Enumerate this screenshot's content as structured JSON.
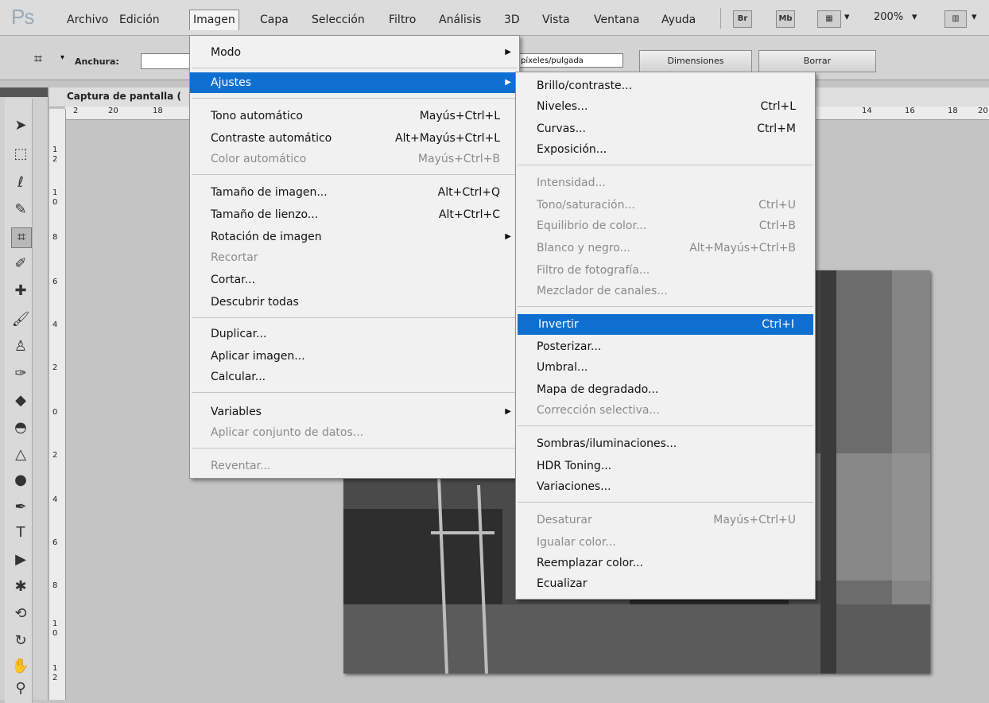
{
  "app": {
    "logo": "Ps"
  },
  "menubar": {
    "items": [
      "Archivo",
      "Edición",
      "Imagen",
      "Capa",
      "Selección",
      "Filtro",
      "Análisis",
      "3D",
      "Vista",
      "Ventana",
      "Ayuda"
    ],
    "br_label": "Br",
    "mb_label": "Mb",
    "zoom": "200%"
  },
  "options": {
    "width_label": "Anchura:",
    "resolution_unit": "píxeles/pulgada",
    "dimensions_button": "Dimensiones",
    "clear_button": "Borrar"
  },
  "document": {
    "tab_title": "Captura de pantalla ("
  },
  "ruler": {
    "h_left": [
      "2",
      "20",
      "18"
    ],
    "h_right": [
      "14",
      "16",
      "18",
      "20"
    ],
    "v": [
      "1",
      "2",
      "1",
      "0",
      "8",
      "6",
      "4",
      "2",
      "0",
      "2",
      "4",
      "6",
      "8",
      "1",
      "0",
      "1",
      "2"
    ]
  },
  "imagen_menu": {
    "items": [
      {
        "label": "Modo",
        "shortcut": "",
        "submenu": true,
        "disabled": false
      },
      {
        "label": "Ajustes",
        "shortcut": "",
        "submenu": true,
        "disabled": false,
        "highlighted": true
      },
      {
        "label": "Tono automático",
        "shortcut": "Mayús+Ctrl+L",
        "disabled": false
      },
      {
        "label": "Contraste automático",
        "shortcut": "Alt+Mayús+Ctrl+L",
        "disabled": false
      },
      {
        "label": "Color automático",
        "shortcut": "Mayús+Ctrl+B",
        "disabled": true
      },
      {
        "label": "Tamaño de imagen...",
        "shortcut": "Alt+Ctrl+Q",
        "disabled": false
      },
      {
        "label": "Tamaño de lienzo...",
        "shortcut": "Alt+Ctrl+C",
        "disabled": false
      },
      {
        "label": "Rotación de imagen",
        "shortcut": "",
        "submenu": true,
        "disabled": false
      },
      {
        "label": "Recortar",
        "shortcut": "",
        "disabled": true
      },
      {
        "label": "Cortar...",
        "shortcut": "",
        "disabled": false
      },
      {
        "label": "Descubrir todas",
        "shortcut": "",
        "disabled": false
      },
      {
        "label": "Duplicar...",
        "shortcut": "",
        "disabled": false
      },
      {
        "label": "Aplicar imagen...",
        "shortcut": "",
        "disabled": false
      },
      {
        "label": "Calcular...",
        "shortcut": "",
        "disabled": false
      },
      {
        "label": "Variables",
        "shortcut": "",
        "submenu": true,
        "disabled": false
      },
      {
        "label": "Aplicar conjunto de datos...",
        "shortcut": "",
        "disabled": true
      },
      {
        "label": "Reventar...",
        "shortcut": "",
        "disabled": true
      }
    ]
  },
  "ajustes_menu": {
    "items": [
      {
        "label": "Brillo/contraste...",
        "shortcut": "",
        "disabled": false
      },
      {
        "label": "Niveles...",
        "shortcut": "Ctrl+L",
        "disabled": false
      },
      {
        "label": "Curvas...",
        "shortcut": "Ctrl+M",
        "disabled": false
      },
      {
        "label": "Exposición...",
        "shortcut": "",
        "disabled": false
      },
      {
        "label": "Intensidad...",
        "shortcut": "",
        "disabled": true
      },
      {
        "label": "Tono/saturación...",
        "shortcut": "Ctrl+U",
        "disabled": true
      },
      {
        "label": "Equilibrio de color...",
        "shortcut": "Ctrl+B",
        "disabled": true
      },
      {
        "label": "Blanco y negro...",
        "shortcut": "Alt+Mayús+Ctrl+B",
        "disabled": true
      },
      {
        "label": "Filtro de fotografía...",
        "shortcut": "",
        "disabled": true
      },
      {
        "label": "Mezclador de canales...",
        "shortcut": "",
        "disabled": true
      },
      {
        "label": "Invertir",
        "shortcut": "Ctrl+I",
        "disabled": false,
        "highlighted": true
      },
      {
        "label": "Posterizar...",
        "shortcut": "",
        "disabled": false
      },
      {
        "label": "Umbral...",
        "shortcut": "",
        "disabled": false
      },
      {
        "label": "Mapa de degradado...",
        "shortcut": "",
        "disabled": false
      },
      {
        "label": "Corrección selectiva...",
        "shortcut": "",
        "disabled": true
      },
      {
        "label": "Sombras/iluminaciones...",
        "shortcut": "",
        "disabled": false
      },
      {
        "label": "HDR Toning...",
        "shortcut": "",
        "disabled": false
      },
      {
        "label": "Variaciones...",
        "shortcut": "",
        "disabled": false
      },
      {
        "label": "Desaturar",
        "shortcut": "Mayús+Ctrl+U",
        "disabled": true
      },
      {
        "label": "Igualar color...",
        "shortcut": "",
        "disabled": true
      },
      {
        "label": "Reemplazar color...",
        "shortcut": "",
        "disabled": false
      },
      {
        "label": "Ecualizar",
        "shortcut": "",
        "disabled": false
      }
    ]
  },
  "colors": {
    "highlight": "#0f6fd1",
    "menu_bg": "#f1f1f1",
    "disabled": "#8a8a8a"
  }
}
